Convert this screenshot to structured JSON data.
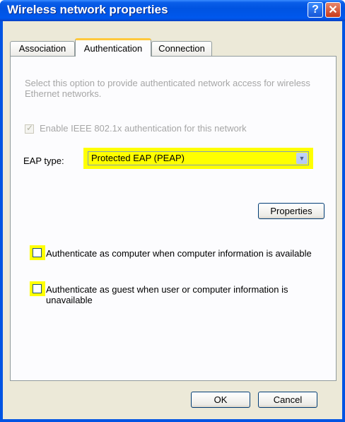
{
  "window": {
    "title": "Wireless network properties"
  },
  "tabs": [
    {
      "label": "Association"
    },
    {
      "label": "Authentication"
    },
    {
      "label": "Connection"
    }
  ],
  "auth": {
    "description": "Select this option to provide authenticated network access for wireless Ethernet networks.",
    "enable_8021x_label": "Enable IEEE 802.1x authentication for this network",
    "eap_type_label": "EAP type:",
    "eap_type_value": "Protected EAP (PEAP)",
    "properties_button": "Properties",
    "auth_as_computer_label": "Authenticate as computer when computer information is available",
    "auth_as_guest_label": "Authenticate as guest when user or computer information is unavailable"
  },
  "footer": {
    "ok_label": "OK",
    "cancel_label": "Cancel"
  },
  "colors": {
    "highlight": "#ffff00",
    "titlebar": "#0054e3",
    "dialog_bg": "#ece9d8"
  },
  "icons": {
    "help": "help-icon",
    "close": "close-icon",
    "dropdown": "chevron-down-icon"
  }
}
